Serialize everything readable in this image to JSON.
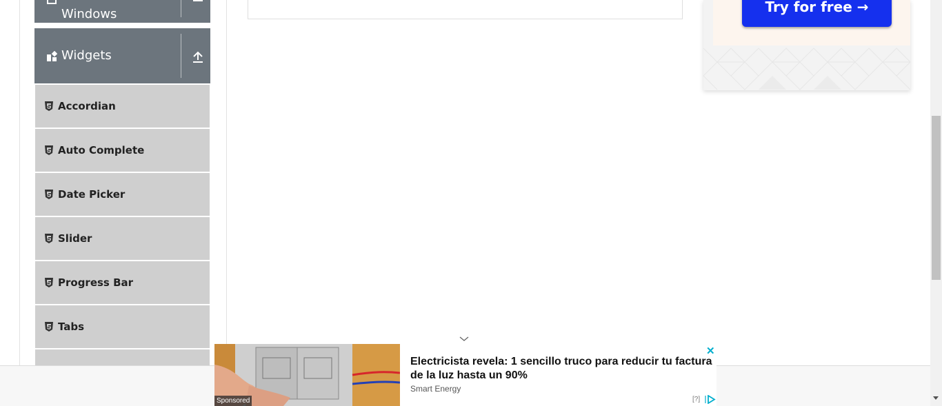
{
  "sidebar": {
    "alerts_group": {
      "label": "Windows"
    },
    "widgets_group": {
      "label": "Widgets"
    },
    "items": [
      {
        "label": "Accordian"
      },
      {
        "label": "Auto Complete"
      },
      {
        "label": "Date Picker"
      },
      {
        "label": "Slider"
      },
      {
        "label": "Progress Bar"
      },
      {
        "label": "Tabs"
      }
    ]
  },
  "promo": {
    "button_label": "Try for free →"
  },
  "sponsored_ad": {
    "badge": "Sponsored",
    "headline": "Electricista revela: 1 sencillo truco para reducir tu factura de la luz hasta un 90%",
    "source": "Smart Energy",
    "help_label": "[?]",
    "close_label": "✕"
  },
  "colors": {
    "sidebar_header": "#6c757d",
    "sidebar_item": "#cfcfcf",
    "promo_button": "#1530ee",
    "ad_close": "#00aecd"
  }
}
